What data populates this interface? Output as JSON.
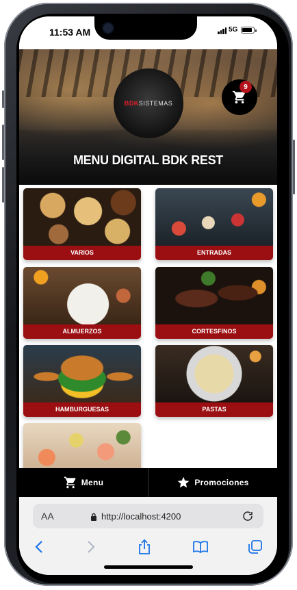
{
  "status_bar": {
    "time": "11:53 AM",
    "network": "5G"
  },
  "header": {
    "logo": {
      "brand_highlight": "BDK",
      "brand_rest": "SISTEMAS"
    },
    "cart_count": "9",
    "title": "MENU DIGITAL BDK REST"
  },
  "categories": [
    {
      "label": "VARIOS"
    },
    {
      "label": "ENTRADAS"
    },
    {
      "label": "ALMUERZOS"
    },
    {
      "label": "CORTESFINOS"
    },
    {
      "label": "HAMBURGUESAS"
    },
    {
      "label": "PASTAS"
    },
    {
      "label": ""
    }
  ],
  "bottom_nav": {
    "menu": "Menu",
    "promociones": "Promociones"
  },
  "browser": {
    "aa": "AA",
    "url": "http://localhost:4200"
  },
  "colors": {
    "accent": "#9b0f12",
    "badge": "#b3121c",
    "nav_bg": "#000000",
    "ios_blue": "#1a73e8"
  },
  "icons": {
    "cart": "cart-icon",
    "star": "star-icon",
    "lock": "lock-icon",
    "reload": "reload-icon",
    "back": "back-icon",
    "forward": "forward-icon",
    "share": "share-icon",
    "bookmarks": "bookmarks-icon",
    "tabs": "tabs-icon"
  }
}
